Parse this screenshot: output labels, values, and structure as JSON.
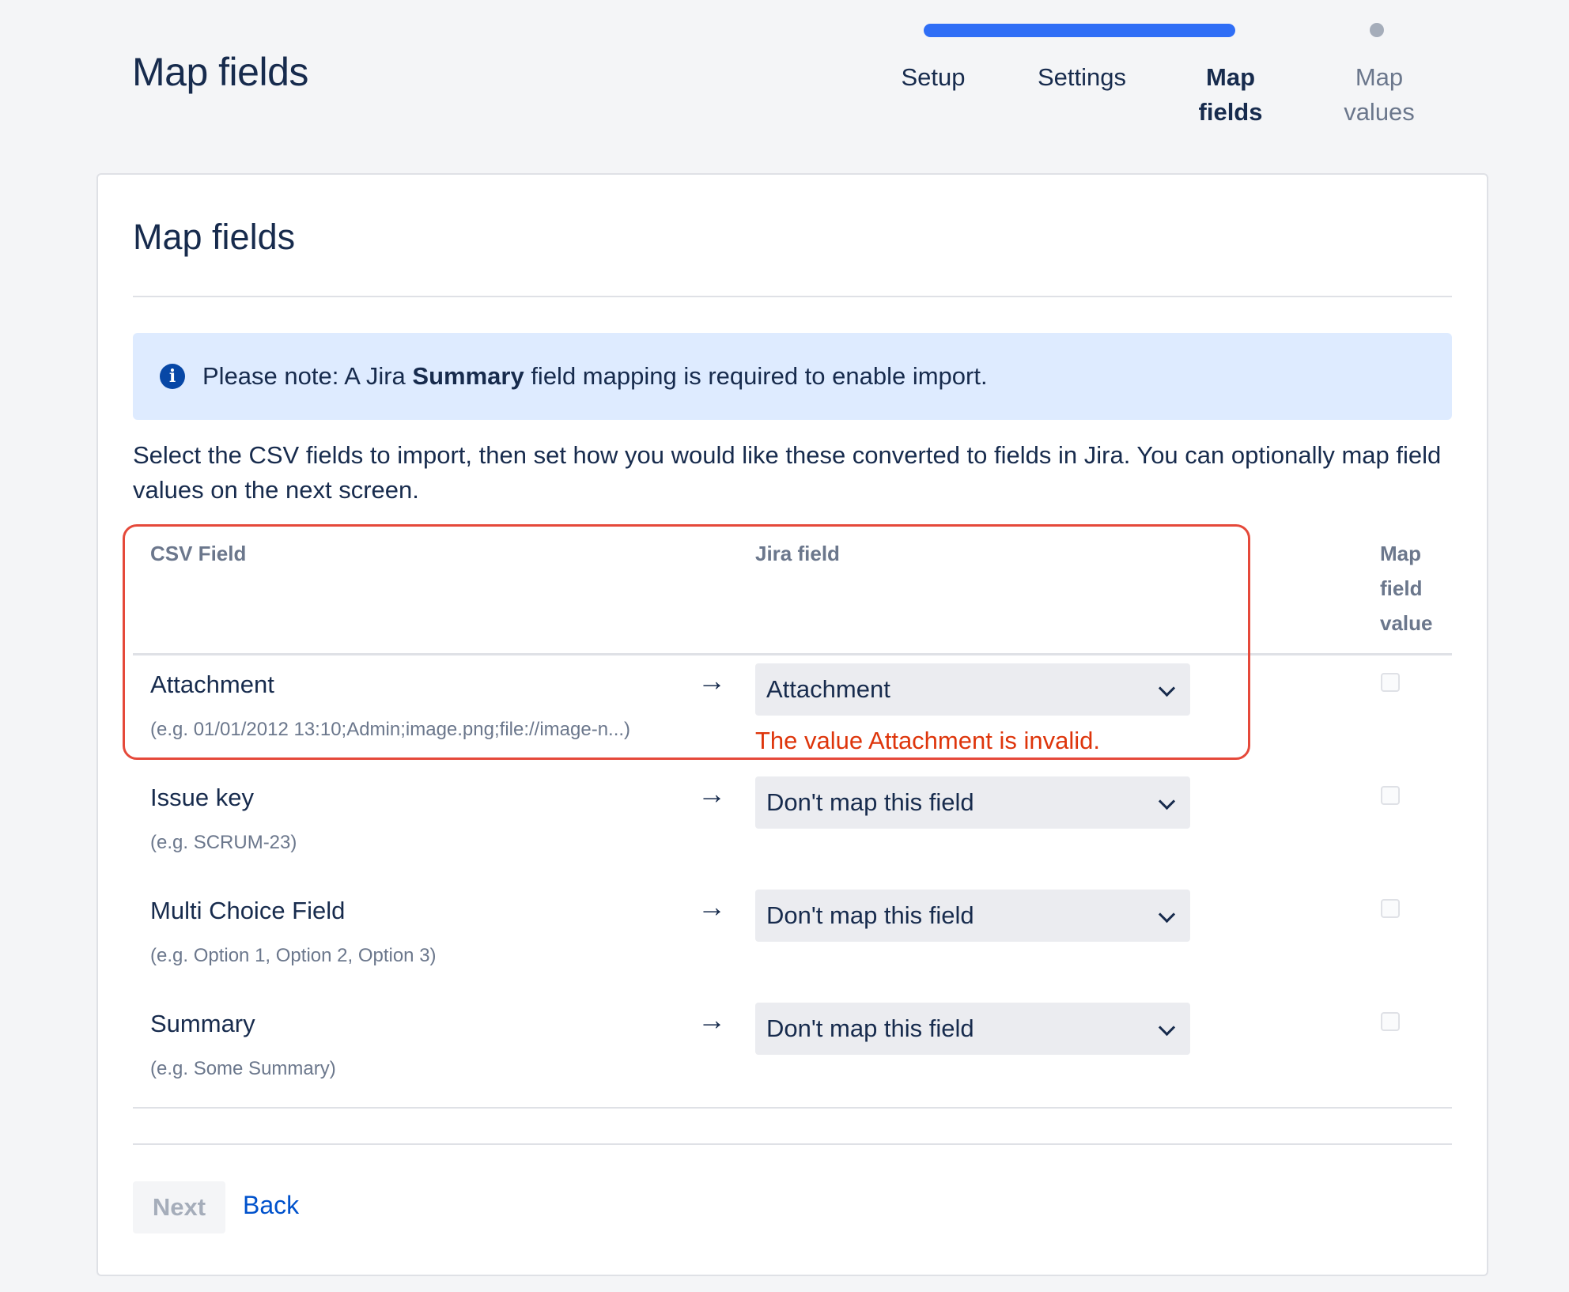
{
  "header": {
    "title": "Map fields",
    "steps": [
      {
        "label": "Setup"
      },
      {
        "label": "Settings"
      },
      {
        "label": "Map fields"
      },
      {
        "label": "Map values"
      }
    ],
    "progress_fraction": 0.75
  },
  "card": {
    "title": "Map fields",
    "note": {
      "prefix": "Please note: A Jira ",
      "bold": "Summary",
      "suffix": " field mapping is required to enable import."
    },
    "description": "Select the CSV fields to import, then set how you would like these converted to fields in Jira. You can optionally map field values on the next screen.",
    "columns": {
      "csv_field": "CSV Field",
      "jira_field": "Jira field",
      "map_value": "Map field value"
    },
    "rows": [
      {
        "label": "Attachment",
        "example": "(e.g.  01/01/2012 13:10;Admin;image.png;file://image-n...)",
        "arrow": "→",
        "selected": "Attachment",
        "error": "The value Attachment is invalid.",
        "map_value": false
      },
      {
        "label": "Issue key",
        "example": "(e.g.  SCRUM-23)",
        "arrow": "→",
        "selected": "Don't map this field",
        "map_value": false
      },
      {
        "label": "Multi Choice Field",
        "example": "(e.g.  Option 1, Option 2, Option 3)",
        "arrow": "→",
        "selected": "Don't map this field",
        "map_value": false
      },
      {
        "label": "Summary",
        "example": "(e.g.  Some Summary)",
        "arrow": "→",
        "selected": "Don't map this field",
        "map_value": false
      }
    ],
    "buttons": {
      "next": "Next",
      "back": "Back"
    }
  },
  "colors": {
    "progress": "#2f6ef6",
    "error": "#de350b",
    "highlight_border": "#e5493a",
    "link": "#0052cc",
    "info_bg": "#deebff"
  }
}
